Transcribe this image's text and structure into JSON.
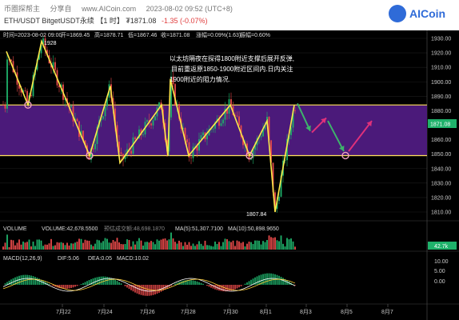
{
  "header": {
    "site_links": [
      "币圈探帮主",
      "分享自",
      "www.AICoin.com",
      "2023-08-02 09:52 (UTC+8)"
    ],
    "symbol": "ETH/USDT BitgetUSDT永续",
    "interval": "【1 时】",
    "price": "₮1871.08",
    "change": "-1.35 (-0.07%)",
    "logo_text": "AICoin"
  },
  "ohlc": {
    "time": "时间=2023-08-02 09:00",
    "open": "开=1869.45",
    "high": "高=1878.71",
    "low": "低=1867.46",
    "close": "收=1871.08",
    "change_pct": "涨幅=0.09%(1.63)",
    "amplitude": "振幅=0.60%"
  },
  "price_axis": [
    "1930.00",
    "1920.00",
    "1910.00",
    "1900.00",
    "1890.00",
    "1880.00",
    "1870.00",
    "1860.00",
    "1850.00",
    "1840.00",
    "1830.00",
    "1820.00",
    "1810.00"
  ],
  "current_price_tag": "1871.08",
  "annotations": {
    "high_label": "1928",
    "low_label": "1807.84",
    "note": [
      "以太坊隔夜在探得1800附近支撑后展开反弹,",
      "目前重返原1850-1900附近区间内.日内关注",
      "1900附近的阻力情况."
    ]
  },
  "volume": {
    "label": "VOLUME",
    "vol": "VOLUME:42,678.5500",
    "forecast": "预估成交额:48,698.1870",
    "ma5": "MA(5):51,307.7100",
    "ma10": "MA(10):50,898.9650",
    "axis_tag": "42.7k"
  },
  "macd": {
    "label": "MACD(12,26,9)",
    "dif": "DIF:5.06",
    "dea": "DEA:0.05",
    "macd": "MACD:10.02",
    "axis": [
      "10.00",
      "5.00",
      "0.00"
    ]
  },
  "time_axis": [
    "7月22",
    "7月24",
    "7月26",
    "7月28",
    "7月30",
    "8月1",
    "8月3",
    "8月5",
    "8月7"
  ],
  "colors": {
    "up": "#1fb26b",
    "down": "#e84a4a",
    "zone": "#4b1a7a",
    "zone_line": "#ffe15a",
    "pattern": "#ffe94a",
    "arrow_up": "#e0317a",
    "arrow_green": "#3db36b"
  }
}
